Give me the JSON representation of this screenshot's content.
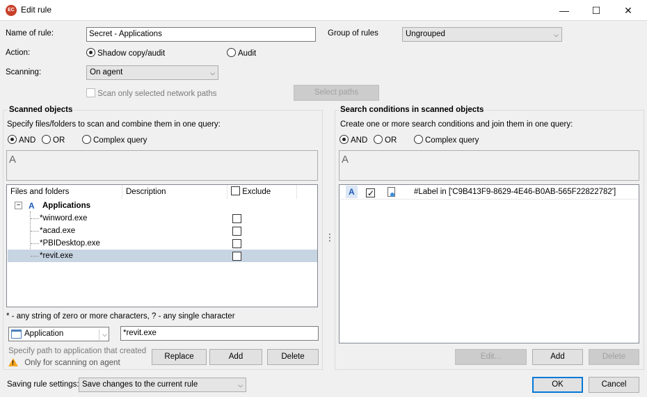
{
  "window": {
    "title": "Edit rule",
    "app_icon_text": "EC",
    "minimize": "—",
    "maximize": "☐",
    "close": "✕"
  },
  "rule": {
    "name_label": "Name of rule:",
    "name_value": "Secret - Applications",
    "group_label": "Group of rules",
    "group_value": "Ungrouped",
    "action_label": "Action:",
    "action_shadow": "Shadow copy/audit",
    "action_audit": "Audit",
    "scanning_label": "Scanning:",
    "scanning_value": "On agent",
    "scan_network_label": "Scan only selected network paths",
    "select_paths": "Select paths"
  },
  "scanned": {
    "title": "Scanned objects",
    "hint": "Specify files/folders to scan and combine them in one query:",
    "and": "AND",
    "or": "OR",
    "complex": "Complex query",
    "query": "A",
    "col_files": "Files and folders",
    "col_desc": "Description",
    "col_exclude": "Exclude",
    "root_badge": "A",
    "root_label": "Applications",
    "items": [
      "*winword.exe",
      "*acad.exe",
      "*PBIDesktop.exe",
      "*revit.exe"
    ],
    "wildcard_hint": "* - any string of zero or more characters, ? - any single character",
    "type_value": "Application",
    "path_value": "*revit.exe",
    "path_hint": "Specify path to application that created tl",
    "agent_warning": "Only for scanning on agent",
    "replace": "Replace",
    "add": "Add",
    "delete": "Delete"
  },
  "search": {
    "title": "Search conditions in scanned objects",
    "hint": "Create one or more search conditions and join them in one query:",
    "and": "AND",
    "or": "OR",
    "complex": "Complex query",
    "query": "A",
    "row_badge": "A",
    "row_condition": "#Label in ['C9B413F9-8629-4E46-B0AB-565F22822782']",
    "edit": "Edit...",
    "add": "Add",
    "delete": "Delete"
  },
  "footer": {
    "saving_label": "Saving rule settings:",
    "saving_value": "Save changes to the current rule",
    "ok": "OK",
    "cancel": "Cancel"
  },
  "splitter": "⋮",
  "tree_toggle": "−",
  "dropdown_arrow": "⌵",
  "warning_mark": "!"
}
